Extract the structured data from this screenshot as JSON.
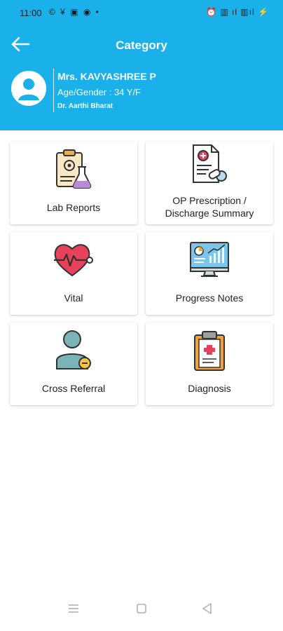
{
  "status_bar": {
    "time": "11:00",
    "left_icons": "© ¥ ▣ ◉ •",
    "right_icons": "⏰ ▥ ıl ▥ıl ⚡"
  },
  "header": {
    "title": "Category",
    "patient_name": "Mrs. KAVYASHREE P",
    "age_gender": "Age/Gender : 34 Y/F",
    "doctor": "Dr. Aarthi Bharat",
    "bg_color": "#1ab1ea"
  },
  "categories": [
    {
      "label": "Lab Reports",
      "icon": "lab-report-icon"
    },
    {
      "label": "OP Prescription / Discharge Summary",
      "line1": "OP Prescription /",
      "line2": "Discharge Summary",
      "icon": "prescription-icon"
    },
    {
      "label": "Vital",
      "icon": "heart-pulse-icon"
    },
    {
      "label": "Progress Notes",
      "icon": "monitor-chart-icon"
    },
    {
      "label": "Cross Referral",
      "icon": "user-referral-icon"
    },
    {
      "label": "Diagnosis",
      "icon": "clipboard-icon"
    }
  ],
  "nav": {
    "menu_icon": "menu-icon",
    "home_icon": "square-icon",
    "back_icon": "triangle-back-icon"
  }
}
